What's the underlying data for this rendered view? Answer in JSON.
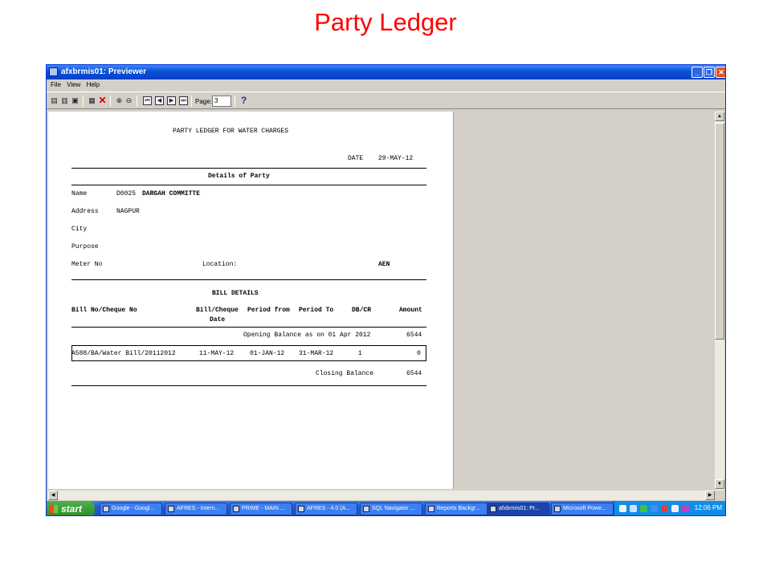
{
  "slide_title": "Party Ledger",
  "window": {
    "title": "afxbrmis01: Previewer",
    "menu": [
      "File",
      "View",
      "Help"
    ],
    "page_label": "Page:",
    "page_value": "3"
  },
  "report": {
    "heading": "PARTY LEDGER FOR WATER CHARGES",
    "date_label": "DATE",
    "date_value": "29-MAY-12",
    "details_heading": "Details of Party",
    "name_label": "Name",
    "name_code": "D0025",
    "name_value": "DARGAH COMMITTE",
    "address_label": "Address",
    "address_value": "NAGPUR",
    "city_label": "City",
    "purpose_label": "Purpose",
    "meter_label": "Meter No",
    "location_label": "Location:",
    "location_value": "AEN",
    "bill_heading": "BILL DETAILS",
    "columns": {
      "bill_no": "Bill No/Cheque No",
      "bill_date_1": "Bill/Cheque",
      "bill_date_2": "Date",
      "period_from": "Period from",
      "period_to": "Period To",
      "dbcr": "DB/CR",
      "amount": "Amount"
    },
    "opening_label": "Opening Balance as on 01 Apr 2012",
    "opening_value": "6544",
    "row": {
      "bill_no": "A588/BA/Water Bill/20112012",
      "bill_date": "11-MAY-12",
      "period_from": "01-JAN-12",
      "period_to": "31-MAR-12",
      "dbcr": "1",
      "amount": "0"
    },
    "closing_label": "Closing Balance",
    "closing_value": "6544"
  },
  "taskbar": {
    "start": "start",
    "items": [
      "Google - Googl...",
      "AFRES - Intern...",
      "PRIME - MAIN ...",
      "AFRES - 4.0 (A...",
      "SQL Navigator ...",
      "Reports Backgr...",
      "afxbrmis01: Pr...",
      "Microsoft Powe..."
    ],
    "clock": "12:06 PM"
  }
}
